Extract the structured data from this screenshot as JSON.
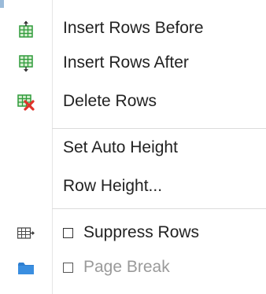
{
  "menu": {
    "items": [
      {
        "label": "Insert Rows Before",
        "icon": "insert-rows-before-icon"
      },
      {
        "label": "Insert Rows After",
        "icon": "insert-rows-after-icon"
      },
      {
        "label": "Delete Rows",
        "icon": "delete-rows-icon"
      },
      {
        "label": "Set Auto Height"
      },
      {
        "label": "Row Height..."
      },
      {
        "label": "Suppress Rows",
        "icon": "suppress-rows-icon",
        "checkbox": false
      },
      {
        "label": "Page Break",
        "icon": "folder-icon",
        "checkbox": false,
        "disabled": true
      }
    ]
  },
  "colors": {
    "grid_green": "#2e9b3a",
    "grid_cell": "#cfe8c8",
    "delete_red": "#e0322a",
    "folder_blue": "#2f7fd1",
    "disabled_text": "#9a9a9a"
  }
}
